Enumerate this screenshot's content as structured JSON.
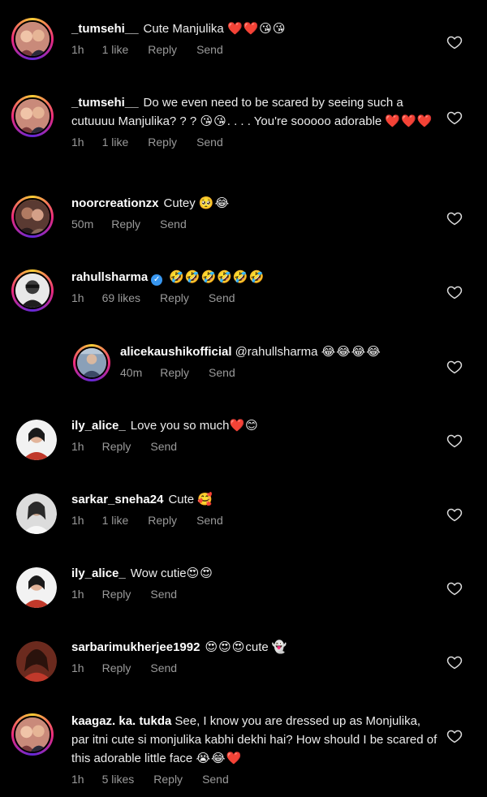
{
  "colors": {
    "background": "#000000",
    "text": "#ececec",
    "meta_text": "#9a9a9a",
    "story_ring": [
      "#f9ce34",
      "#ee2a7b",
      "#6228d7"
    ],
    "verified": "#3897f0"
  },
  "icons": {
    "like": "heart-outline-icon",
    "verified": "verified-badge-icon"
  },
  "comments": [
    {
      "username": "_tumsehi__",
      "text": "Cute Manjulika",
      "emoji": "❤️❤️😘😘",
      "time": "1h",
      "likes": "1 like",
      "reply": "Reply",
      "send": "Send"
    },
    {
      "username": "_tumsehi__",
      "text": "Do we even need to be scared by seeing such a cutuuuu Manjulika? ? ?",
      "emoji": "😘😘",
      "text2": ". . . .  You're sooooo adorable",
      "emoji2": "❤️❤️❤️",
      "time": "1h",
      "likes": "1 like",
      "reply": "Reply",
      "send": "Send"
    },
    {
      "username": "noorcreationzx",
      "text": "Cutey",
      "emoji": "🥺😂",
      "time": "50m",
      "reply": "Reply",
      "send": "Send"
    },
    {
      "username": "rahullsharma",
      "text": "",
      "emoji": "🤣🤣🤣🤣🤣🤣",
      "time": "1h",
      "likes": "69 likes",
      "reply": "Reply",
      "send": "Send"
    },
    {
      "username": "alicekaushikofficial",
      "text": "@rahullsharma",
      "emoji": "😂😂😂😂",
      "time": "40m",
      "reply": "Reply",
      "send": "Send"
    },
    {
      "username": "ily_alice_",
      "text": "Love you so much",
      "emoji": "❤️😊",
      "time": "1h",
      "reply": "Reply",
      "send": "Send"
    },
    {
      "username": "sarkar_sneha24",
      "text": "Cute",
      "emoji": "🥰",
      "time": "1h",
      "likes": "1 like",
      "reply": "Reply",
      "send": "Send"
    },
    {
      "username": "ily_alice_",
      "text": "Wow cutie",
      "emoji": "😍😍",
      "time": "1h",
      "reply": "Reply",
      "send": "Send"
    },
    {
      "username": "sarbarimukherjee1992",
      "text": "",
      "emoji": "😍😍😍",
      "text2": "cute",
      "emoji2": "👻",
      "time": "1h",
      "reply": "Reply",
      "send": "Send"
    },
    {
      "username": "kaagaz. ka. tukda",
      "text": "See,  I know you are dressed up as Monjulika,  par itni cute si monjulika kabhi dekhi hai?  How should I be scared of this adorable little face",
      "emoji": "😭😂❤️",
      "time": "1h",
      "likes": "5 likes",
      "reply": "Reply",
      "send": "Send"
    }
  ]
}
